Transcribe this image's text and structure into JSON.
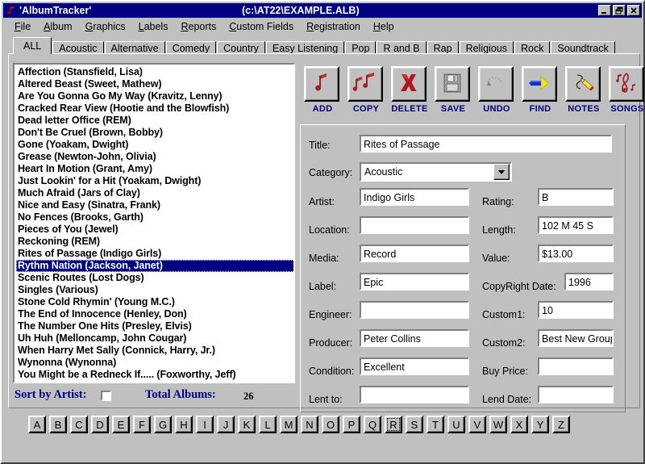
{
  "window": {
    "icon": "music-note-icon",
    "title": "'AlbumTracker'",
    "file_path": "(c:\\AT22\\EXAMPLE.ALB)",
    "buttons": {
      "minimize": "minimize-icon",
      "restore": "restore-icon",
      "close": "close-icon"
    }
  },
  "menu": [
    {
      "label": "File",
      "accel": "F"
    },
    {
      "label": "Album",
      "accel": "A"
    },
    {
      "label": "Graphics",
      "accel": "G"
    },
    {
      "label": "Labels",
      "accel": "L"
    },
    {
      "label": "Reports",
      "accel": "R"
    },
    {
      "label": "Custom Fields",
      "accel": "C"
    },
    {
      "label": "Registration",
      "accel": "R"
    },
    {
      "label": "Help",
      "accel": "H"
    }
  ],
  "tabs": {
    "active": "ALL",
    "items": [
      "ALL",
      "Acoustic",
      "Alternative",
      "Comedy",
      "Country",
      "Easy Listening",
      "Pop",
      "R and B",
      "Rap",
      "Religious",
      "Rock",
      "Soundtrack"
    ]
  },
  "album_list": {
    "selected_index": 16,
    "items": [
      "Affection (Stansfield, Lisa)",
      "Altered Beast (Sweet, Mathew)",
      "Are You Gonna Go My Way (Kravitz, Lenny)",
      "Cracked Rear View (Hootie and the Blowfish)",
      "Dead letter Office (REM)",
      "Don't Be Cruel (Brown, Bobby)",
      "Gone (Yoakam, Dwight)",
      "Grease (Newton-John, Olivia)",
      "Heart In Motion (Grant, Amy)",
      "Just Lookin' for a Hit (Yoakam, Dwight)",
      "Much Afraid (Jars of Clay)",
      "Nice and Easy (Sinatra, Frank)",
      "No Fences (Brooks, Garth)",
      "Pieces of You (Jewel)",
      "Reckoning (REM)",
      "Rites of Passage (Indigo Girls)",
      "Rythm Nation (Jackson, Janet)",
      "Scenic Routes (Lost Dogs)",
      "Singles (Various)",
      "Stone Cold Rhymin' (Young M.C.)",
      "The End of Innocence (Henley, Don)",
      "The Number One Hits (Presley, Elvis)",
      "Uh Huh (Melloncamp, John Cougar)",
      "When Harry Met Sally (Connick, Harry, Jr.)",
      "Wynonna (Wynonna)",
      "You Might be a Redneck If..... (Foxworthy, Jeff)"
    ]
  },
  "toolbar": [
    {
      "label": "ADD",
      "icon": "single-note-icon"
    },
    {
      "label": "COPY",
      "icon": "double-note-icon"
    },
    {
      "label": "DELETE",
      "icon": "red-x-icon"
    },
    {
      "label": "SAVE",
      "icon": "floppy-disk-icon"
    },
    {
      "label": "UNDO",
      "icon": "undo-arrow-icon"
    },
    {
      "label": "FIND",
      "icon": "flashlight-icon"
    },
    {
      "label": "NOTES",
      "icon": "pencil-icon"
    },
    {
      "label": "SONGS",
      "icon": "treble-clef-icon"
    }
  ],
  "details": {
    "title": {
      "label": "Title:",
      "value": "Rites of Passage"
    },
    "category": {
      "label": "Category:",
      "value": "Acoustic"
    },
    "artist": {
      "label": "Artist:",
      "value": "Indigo Girls"
    },
    "rating": {
      "label": "Rating:",
      "value": "B"
    },
    "location": {
      "label": "Location:",
      "value": ""
    },
    "length": {
      "label": "Length:",
      "value": "102 M 45 S"
    },
    "media": {
      "label": "Media:",
      "value": "Record"
    },
    "value": {
      "label": "Value:",
      "value": "$13.00"
    },
    "label_field": {
      "label": "Label:",
      "value": "Epic"
    },
    "copyright_date": {
      "label": "CopyRight Date:",
      "value": "1996"
    },
    "engineer": {
      "label": "Engineer:",
      "value": ""
    },
    "custom1": {
      "label": "Custom1:",
      "value": "10"
    },
    "producer": {
      "label": "Producer:",
      "value": "Peter Collins"
    },
    "custom2": {
      "label": "Custom2:",
      "value": "Best New Group"
    },
    "condition": {
      "label": "Condition:",
      "value": "Excellent"
    },
    "buy_price": {
      "label": "Buy Price:",
      "value": ""
    },
    "lent_to": {
      "label": "Lent to:",
      "value": ""
    },
    "lend_date": {
      "label": "Lend Date:",
      "value": ""
    }
  },
  "status": {
    "sort_by_artist_label": "Sort by Artist:",
    "sort_by_artist_checked": false,
    "total_albums_label": "Total Albums:",
    "total_albums_value": "26"
  },
  "alphabet": {
    "selected": "R",
    "letters": [
      "A",
      "B",
      "C",
      "D",
      "E",
      "F",
      "G",
      "H",
      "I",
      "J",
      "K",
      "L",
      "M",
      "N",
      "O",
      "P",
      "Q",
      "R",
      "S",
      "T",
      "U",
      "V",
      "W",
      "X",
      "Y",
      "Z"
    ]
  },
  "colors": {
    "titlebar": "#000080",
    "face": "#c0c0c0",
    "selection": "#000080",
    "toolbar_label": "#000080",
    "status_text": "#000080",
    "icon_red": "#a02020"
  }
}
